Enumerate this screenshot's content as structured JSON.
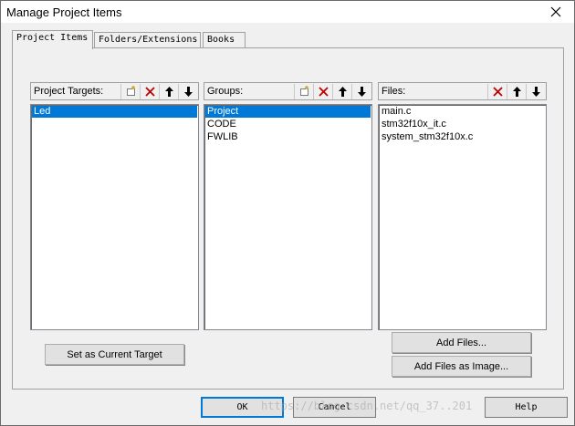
{
  "window": {
    "title": "Manage Project Items"
  },
  "tabs": [
    {
      "label": "Project Items",
      "active": true
    },
    {
      "label": "Folders/Extensions",
      "active": false
    },
    {
      "label": "Books",
      "active": false
    }
  ],
  "targets": {
    "label": "Project Targets:",
    "items": [
      "Led"
    ],
    "selected": 0
  },
  "groups": {
    "label": "Groups:",
    "items": [
      "Project",
      "CODE",
      "FWLIB"
    ],
    "selected": 0
  },
  "files": {
    "label": "Files:",
    "items": [
      "main.c",
      "stm32f10x_it.c",
      "system_stm32f10x.c"
    ]
  },
  "buttons": {
    "set_current_target": "Set as Current Target",
    "add_files": "Add Files...",
    "add_files_image": "Add Files as Image...",
    "ok": "OK",
    "cancel": "Cancel",
    "help": "Help"
  },
  "watermark": "https://blog.csdn.net/qq_37..201",
  "colors": {
    "selection": "#0078d7",
    "delete_icon": "#c00000"
  }
}
